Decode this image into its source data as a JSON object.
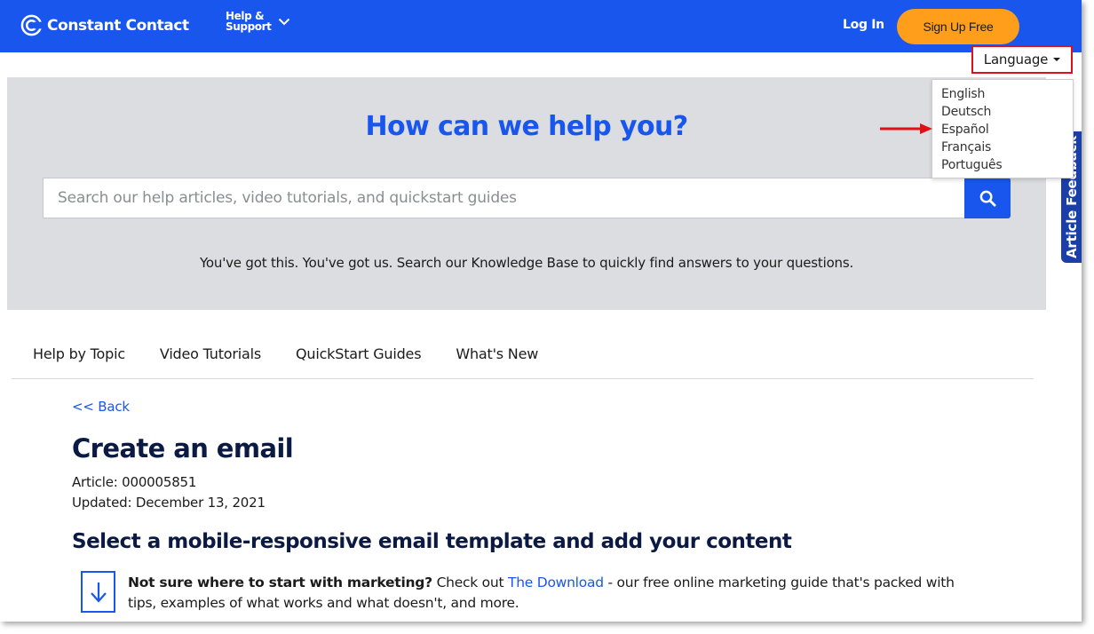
{
  "header": {
    "brand": "Constant Contact",
    "help_line1": "Help &",
    "help_line2": "Support",
    "login_label": "Log In",
    "signup_label": "Sign Up Free",
    "colors": {
      "bar": "#1856ed",
      "signup": "#ff9e1a"
    }
  },
  "language": {
    "label": "Language",
    "options": [
      "English",
      "Deutsch",
      "Español",
      "Français",
      "Português"
    ]
  },
  "hero": {
    "title": "How can we help you?",
    "search_placeholder": "Search our help articles, video tutorials, and quickstart guides",
    "subtitle": "You've got this. You've got us. Search our Knowledge Base to quickly find answers to your questions."
  },
  "feedback_tab": "Article Feedback",
  "tabs": [
    "Help by Topic",
    "Video Tutorials",
    "QuickStart Guides",
    "What's New"
  ],
  "article": {
    "back_label": "<< Back",
    "title": "Create an email",
    "article_id": "Article: 000005851",
    "updated": "Updated: December 13, 2021",
    "section_heading": "Select a mobile-responsive email template and add your content",
    "tip_bold": "Not sure where to start with marketing?",
    "tip_pre_link": " Check out ",
    "tip_link": "The Download",
    "tip_post_link": " - our free online marketing guide that's packed with tips, examples of what works and what doesn't, and more."
  },
  "icons": {
    "logo": "constant-contact-logo-icon",
    "help_chevron": "chevron-down-icon",
    "search": "search-icon",
    "tip": "download-arrow-icon",
    "annotation": "red-arrow-annotation-icon"
  }
}
